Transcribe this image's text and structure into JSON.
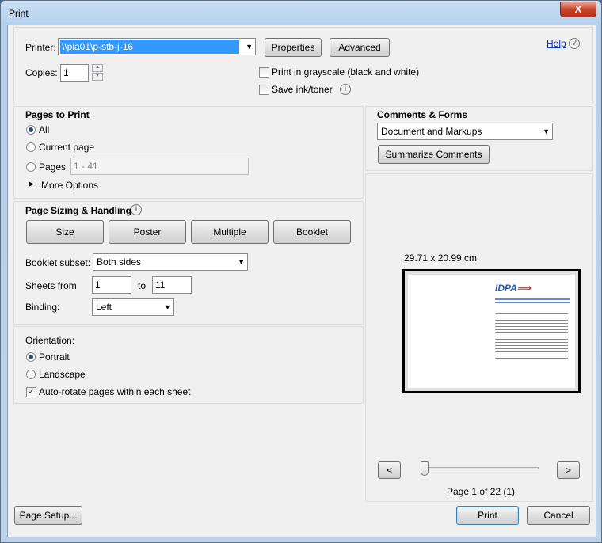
{
  "window": {
    "title": "Print",
    "close": "X"
  },
  "printer": {
    "label": "Printer:",
    "value": "\\\\pia01\\p-stb-j-16",
    "properties": "Properties",
    "advanced": "Advanced",
    "help": "Help"
  },
  "copies": {
    "label": "Copies:",
    "value": "1"
  },
  "options": {
    "grayscale": "Print in grayscale (black and white)",
    "grayscale_checked": false,
    "save_ink": "Save ink/toner",
    "save_ink_checked": false
  },
  "pages": {
    "title": "Pages to Print",
    "all": "All",
    "current": "Current page",
    "pages": "Pages",
    "range_placeholder": "1 - 41",
    "more": "More Options",
    "selected": "All"
  },
  "sizing": {
    "title": "Page Sizing & Handling",
    "buttons": [
      "Size",
      "Poster",
      "Multiple",
      "Booklet"
    ],
    "selected": "Booklet",
    "subset_label": "Booklet subset:",
    "subset_value": "Both sides",
    "sheets_label": "Sheets from",
    "sheets_from": "1",
    "to_label": "to",
    "sheets_to": "11",
    "binding_label": "Binding:",
    "binding_value": "Left"
  },
  "orientation": {
    "title": "Orientation:",
    "portrait": "Portrait",
    "landscape": "Landscape",
    "autorotate": "Auto-rotate pages within each sheet",
    "selected": "Portrait",
    "autorotate_checked": true
  },
  "comments": {
    "title": "Comments & Forms",
    "value": "Document and Markups",
    "summarize": "Summarize Comments"
  },
  "preview": {
    "size": "29.71 x 20.99 cm",
    "page_label": "Page 1 of 22 (1)",
    "prev": "<",
    "next": ">",
    "logo": "IDPA"
  },
  "footer": {
    "page_setup": "Page Setup...",
    "print": "Print",
    "cancel": "Cancel"
  }
}
